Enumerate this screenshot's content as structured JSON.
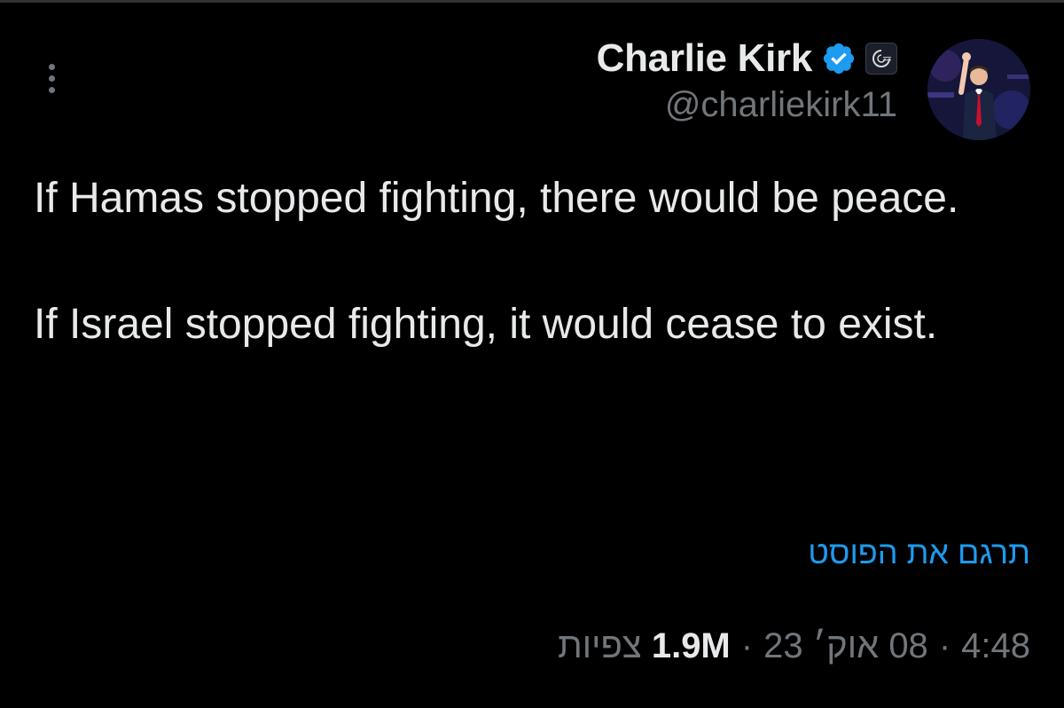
{
  "author": {
    "display_name": "Charlie Kirk",
    "handle": "@charliekirk11",
    "verified": true,
    "avatar_icon": "profile-photo",
    "affiliation_icon": "turning-point-usa-badge"
  },
  "post": {
    "paragraphs": [
      "If Hamas stopped fighting, there would be peace.",
      "If Israel stopped fighting, it would cease to exist."
    ],
    "translate_label": "תרגם את הפוסט"
  },
  "meta": {
    "time": "4:48",
    "separator": "·",
    "date": "08 אוק׳ 23",
    "views_count": "1.9M",
    "views_label": "צפיות"
  },
  "colors": {
    "background": "#000000",
    "text": "#e7e9ea",
    "secondary": "#71767b",
    "accent": "#1d9bf0"
  }
}
